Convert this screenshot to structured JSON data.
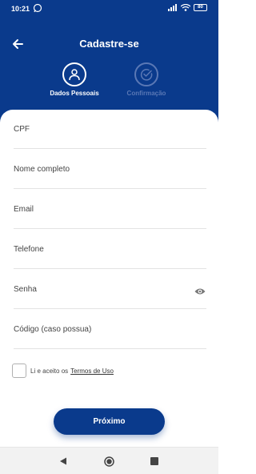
{
  "status_bar": {
    "time": "10:21",
    "battery": "80"
  },
  "header": {
    "title": "Cadastre-se"
  },
  "steps": [
    {
      "label": "Dados Pessoais",
      "state": "active"
    },
    {
      "label": "Confirmação",
      "state": "inactive"
    }
  ],
  "form": {
    "fields": [
      {
        "label": "CPF"
      },
      {
        "label": "Nome completo"
      },
      {
        "label": "Email"
      },
      {
        "label": "Telefone"
      },
      {
        "label": "Senha"
      },
      {
        "label": "Código (caso possua)"
      }
    ],
    "terms_text": "Li e aceito os",
    "terms_link": "Termos de Uso"
  },
  "actions": {
    "next_label": "Próximo"
  },
  "colors": {
    "primary": "#0a3a8c",
    "step_inactive": "#5a78b5"
  },
  "icons": {
    "back": "arrow-left-icon",
    "step1": "user-icon",
    "step2": "check-circle-icon",
    "password_toggle": "eye-icon"
  }
}
